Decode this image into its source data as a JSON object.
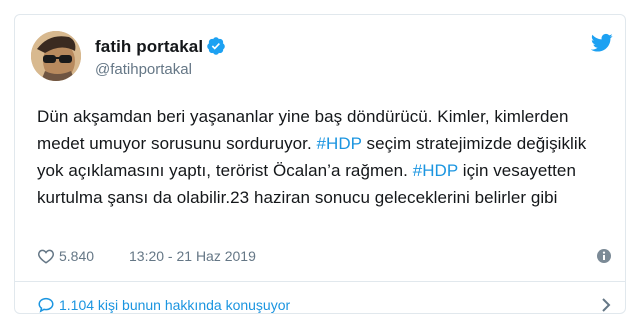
{
  "author": {
    "display_name": "fatih portakal",
    "handle": "@fatihportakal"
  },
  "tweet": {
    "segments": [
      {
        "text": "Dün akşamdan beri yaşananlar yine baş döndürücü. Kimler, kimlerden medet umuyor sorusunu sorduruyor. ",
        "hashtag": false
      },
      {
        "text": "#HDP",
        "hashtag": true
      },
      {
        "text": " seçim stratejimizde değişiklik yok açıklamasını yaptı, terörist Öcalan’a rağmen. ",
        "hashtag": false
      },
      {
        "text": "#HDP",
        "hashtag": true
      },
      {
        "text": " için vesayetten kurtulma şansı da olabilir.23 haziran sonucu geleceklerini belirler gibi",
        "hashtag": false
      }
    ]
  },
  "meta": {
    "like_count": "5.840",
    "timestamp": "13:20 - 21 Haz 2019"
  },
  "footer": {
    "conversation": "1.104 kişi bunun hakkında konuşuyor"
  },
  "colors": {
    "accent": "#1b95e0",
    "twitter_blue": "#1da1f2",
    "muted": "#657786",
    "border": "#e1e8ed"
  },
  "icons": [
    "verified-icon",
    "twitter-logo-icon",
    "heart-icon",
    "info-icon",
    "comment-icon",
    "chevron-right-icon"
  ]
}
